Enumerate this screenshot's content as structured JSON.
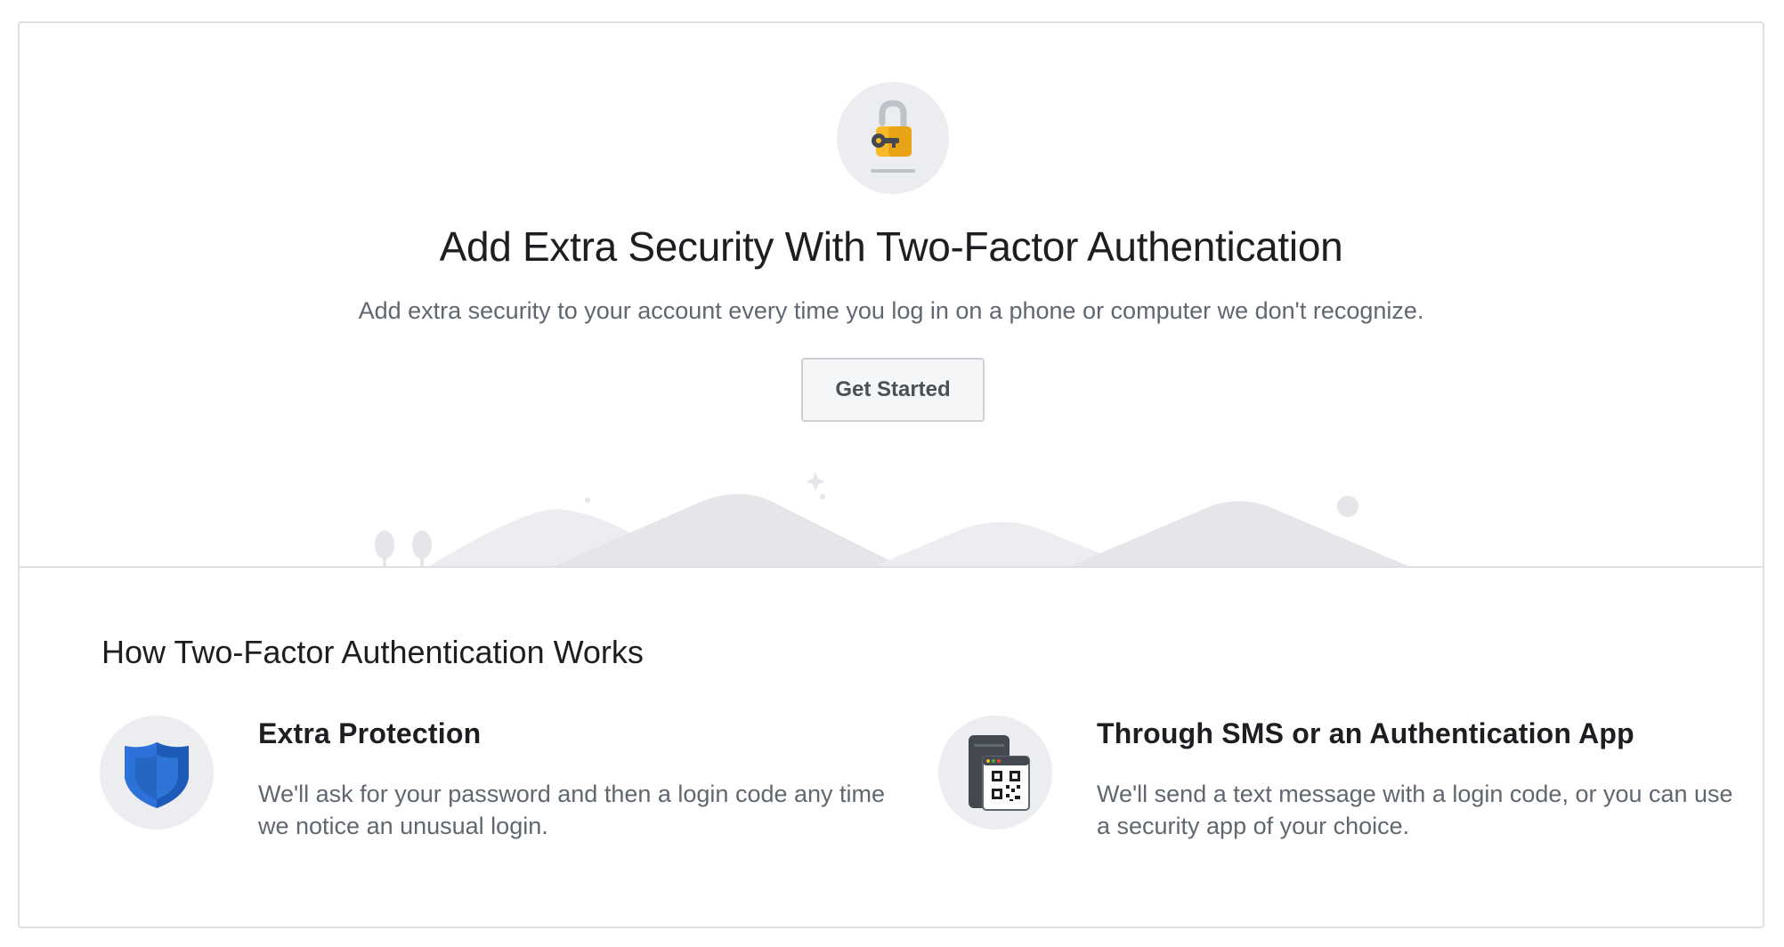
{
  "hero": {
    "title": "Add Extra Security With Two-Factor Authentication",
    "subtitle": "Add extra security to your account every time you log in on a phone or computer we don't recognize.",
    "button_label": "Get Started",
    "icon": "lock-key-icon"
  },
  "how_it_works": {
    "title": "How Two-Factor Authentication Works",
    "features": [
      {
        "icon": "shield-icon",
        "title": "Extra Protection",
        "text": "We'll ask for your password and then a login code any time we notice an unusual login."
      },
      {
        "icon": "qr-code-phone-icon",
        "title": "Through SMS or an Authentication App",
        "text": "We'll send a text message with a login code, or you can use a security app of your choice."
      }
    ]
  },
  "colors": {
    "accent_yellow": "#f7b928",
    "shield_blue": "#2d72d9",
    "text_primary": "#1c1e21",
    "text_secondary": "#606770",
    "border": "#dddfe2"
  }
}
